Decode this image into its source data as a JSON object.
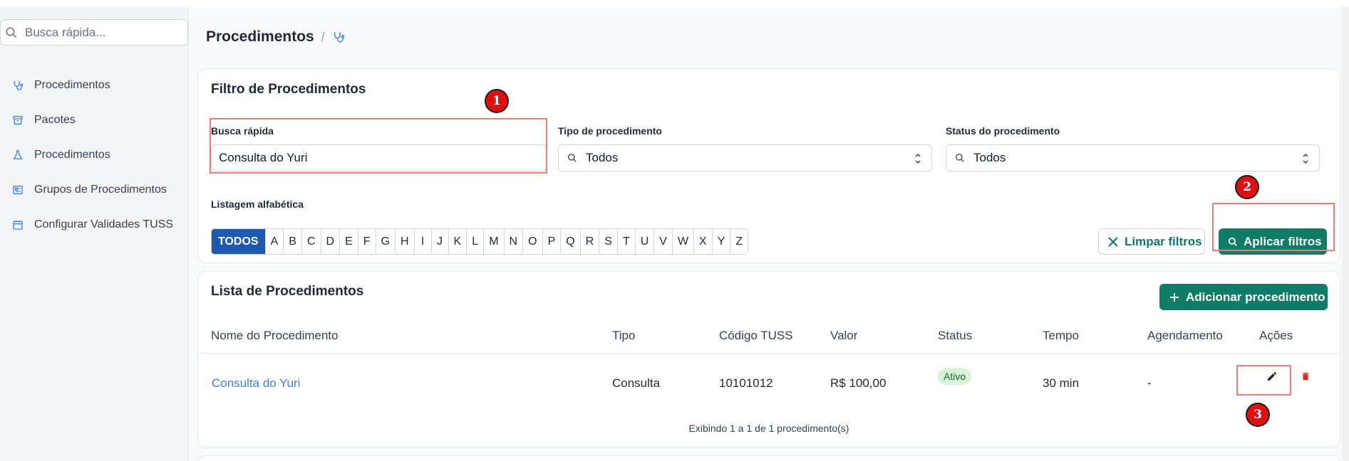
{
  "sidebar": {
    "search_placeholder": "Busca rápida...",
    "items": [
      {
        "label": "Procedimentos",
        "icon": "stethoscope-icon"
      },
      {
        "label": "Pacotes",
        "icon": "archive-icon"
      },
      {
        "label": "Procedimentos",
        "icon": "flask-icon"
      },
      {
        "label": "Grupos de Procedimentos",
        "icon": "group-icon"
      },
      {
        "label": "Configurar Validades TUSS",
        "icon": "calendar-icon"
      }
    ]
  },
  "breadcrumb": {
    "title": "Procedimentos",
    "separator": "/",
    "icon": "stethoscope-icon"
  },
  "filter": {
    "title": "Filtro de Procedimentos",
    "search_label": "Busca rápida",
    "search_value": "Consulta do Yuri",
    "type_label": "Tipo de procedimento",
    "type_value": "Todos",
    "status_label": "Status do procedimento",
    "status_value": "Todos",
    "alpha_label": "Listagem alfabética",
    "alpha_letters": [
      "TODOS",
      "A",
      "B",
      "C",
      "D",
      "E",
      "F",
      "G",
      "H",
      "I",
      "J",
      "K",
      "L",
      "M",
      "N",
      "O",
      "P",
      "Q",
      "R",
      "S",
      "T",
      "U",
      "V",
      "W",
      "X",
      "Y",
      "Z"
    ],
    "clear_label": "Limpar filtros",
    "apply_label": "Aplicar filtros"
  },
  "list": {
    "title": "Lista de Procedimentos",
    "add_label": "Adicionar procedimento",
    "columns": [
      "Nome do Procedimento",
      "Tipo",
      "Código TUSS",
      "Valor",
      "Status",
      "Tempo",
      "Agendamento",
      "Ações"
    ],
    "rows": [
      {
        "name": "Consulta do Yuri",
        "type": "Consulta",
        "tuss": "10101012",
        "value": "R$ 100,00",
        "status": "Ativo",
        "time": "30 min",
        "scheduling": "-"
      }
    ],
    "footer": "Exibindo 1 a 1 de 1 procedimento(s)"
  },
  "annotations": [
    "1",
    "2",
    "3"
  ],
  "colors": {
    "primary": "#0e7c66",
    "alpha_active": "#1e5bb0",
    "link": "#3b82f6",
    "delete": "#dc2626",
    "annotation": "#e01010",
    "badge_bg": "#d9f2d8"
  }
}
